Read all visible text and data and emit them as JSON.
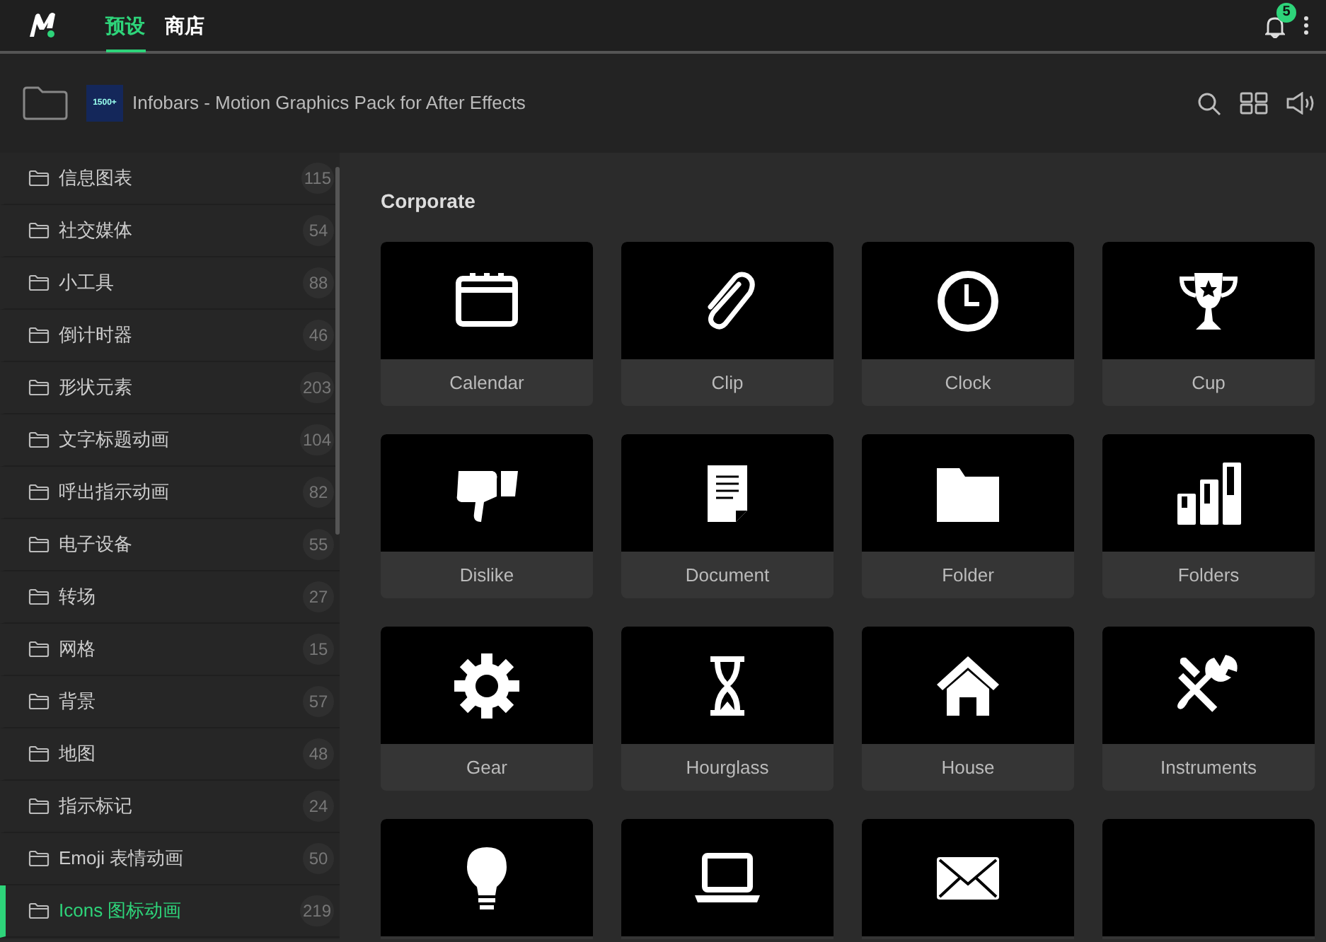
{
  "topbar": {
    "tabs": [
      {
        "label": "预设",
        "selected": true
      },
      {
        "label": "商店",
        "selected": false
      }
    ],
    "notification_count": "5"
  },
  "pack": {
    "thumbnail_text": "1500+",
    "title": "Infobars - Motion Graphics Pack for After Effects"
  },
  "sidebar": {
    "items": [
      {
        "label": "信息图表",
        "count": "115",
        "selected": false
      },
      {
        "label": "社交媒体",
        "count": "54",
        "selected": false
      },
      {
        "label": "小工具",
        "count": "88",
        "selected": false
      },
      {
        "label": "倒计时器",
        "count": "46",
        "selected": false
      },
      {
        "label": "形状元素",
        "count": "203",
        "selected": false
      },
      {
        "label": "文字标题动画",
        "count": "104",
        "selected": false
      },
      {
        "label": "呼出指示动画",
        "count": "82",
        "selected": false
      },
      {
        "label": "电子设备",
        "count": "55",
        "selected": false
      },
      {
        "label": "转场",
        "count": "27",
        "selected": false
      },
      {
        "label": "网格",
        "count": "15",
        "selected": false
      },
      {
        "label": "背景",
        "count": "57",
        "selected": false
      },
      {
        "label": "地图",
        "count": "48",
        "selected": false
      },
      {
        "label": "指示标记",
        "count": "24",
        "selected": false
      },
      {
        "label": "Emoji 表情动画",
        "count": "50",
        "selected": false
      },
      {
        "label": "Icons 图标动画",
        "count": "219",
        "selected": true
      }
    ]
  },
  "section": {
    "title": "Corporate",
    "presets": [
      {
        "kind": "calendar",
        "label": "Calendar"
      },
      {
        "kind": "clip",
        "label": "Clip"
      },
      {
        "kind": "clock",
        "label": "Clock"
      },
      {
        "kind": "cup",
        "label": "Cup"
      },
      {
        "kind": "dislike",
        "label": "Dislike"
      },
      {
        "kind": "document",
        "label": "Document"
      },
      {
        "kind": "folder",
        "label": "Folder"
      },
      {
        "kind": "folders",
        "label": "Folders"
      },
      {
        "kind": "gear",
        "label": "Gear"
      },
      {
        "kind": "hourglass",
        "label": "Hourglass"
      },
      {
        "kind": "house",
        "label": "House"
      },
      {
        "kind": "tools",
        "label": "Instruments"
      },
      {
        "kind": "bulb"
      },
      {
        "kind": "laptop"
      },
      {
        "kind": "envelope"
      },
      {
        "kind": "blank"
      }
    ]
  }
}
